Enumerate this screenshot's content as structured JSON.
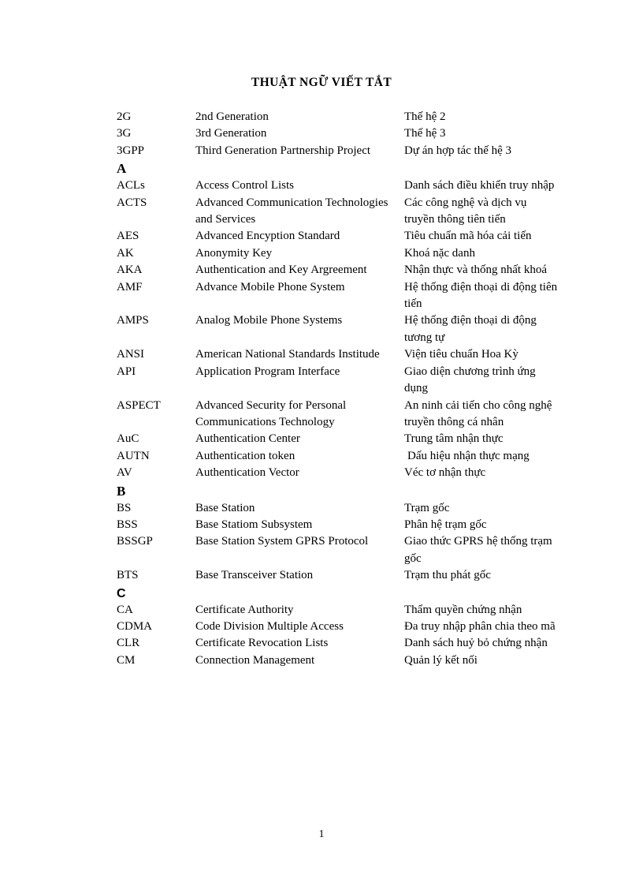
{
  "document": {
    "title": "THUẬT NGỮ VIẾT TẮT",
    "page_number": "1"
  },
  "glossary": {
    "blocks": [
      {
        "type": "entries",
        "rows": [
          {
            "abbr": "2G",
            "english": "2nd Generation",
            "vietnamese": "Thế hệ 2"
          },
          {
            "abbr": "3G",
            "english": "3rd Generation",
            "vietnamese": "Thế hệ 3"
          },
          {
            "abbr": "3GPP",
            "english": "Third Generation Partnership Project",
            "vietnamese": "Dự án hợp tác thế hệ 3"
          }
        ]
      },
      {
        "type": "letter",
        "letter": "A",
        "style": "serif"
      },
      {
        "type": "entries",
        "rows": [
          {
            "abbr": "ACLs",
            "english": "Access Control Lists",
            "vietnamese": "Danh sách điều khiển truy nhập"
          },
          {
            "abbr": "ACTS",
            "english": "Advanced Communication Technologies and Services",
            "vietnamese": "Các công nghệ và dịch vụ truyền thông tiên tiến"
          },
          {
            "abbr": "AES",
            "english": "Advanced Encyption Standard",
            "vietnamese": "Tiêu chuẩn mã hóa cải tiến"
          },
          {
            "abbr": "AK",
            "english": "Anonymity Key",
            "vietnamese": "Khoá nặc danh"
          },
          {
            "abbr": "AKA",
            "english": "Authentication and Key Argreement",
            "vietnamese": "Nhận thực và thống nhất khoá"
          },
          {
            "abbr": "AMF",
            "english": "Advance Mobile Phone System",
            "vietnamese": "Hệ thống điện thoại di động tiên tiến"
          },
          {
            "abbr": "AMPS",
            "english": "Analog Mobile Phone Systems",
            "vietnamese": "Hệ thống điện thoại di động tương tự"
          },
          {
            "abbr": "ANSI",
            "english": "American National Standards Institude",
            "vietnamese": "Viện tiêu chuẩn Hoa Kỳ"
          },
          {
            "abbr": "API",
            "english": "Application Program Interface",
            "vietnamese": "Giao diện chương trình ứng dụng"
          },
          {
            "abbr": "ASPECT",
            "english": "Advanced Security for Personal Communications Technology",
            "vietnamese": "An ninh cải tiến cho công nghệ truyền thông cá nhân"
          },
          {
            "abbr": "AuC",
            "english": "Authentication Center",
            "vietnamese": "Trung tâm nhận thực"
          },
          {
            "abbr": "AUTN",
            "english": "Authentication token",
            "vietnamese": "Dấu hiệu nhận thực mạng",
            "indent_vi": true
          },
          {
            "abbr": "AV",
            "english": "Authentication Vector",
            "vietnamese": "Véc tơ nhận thực"
          }
        ]
      },
      {
        "type": "letter",
        "letter": "B",
        "style": "serif"
      },
      {
        "type": "entries",
        "rows": [
          {
            "abbr": "BS",
            "english": "Base Station",
            "vietnamese": "Trạm gốc"
          },
          {
            "abbr": "BSS",
            "english": "Base Statiom Subsystem",
            "vietnamese": "Phân hệ trạm gốc"
          },
          {
            "abbr": "BSSGP",
            "english": "Base Station System GPRS Protocol",
            "vietnamese": "Giao thức GPRS hệ thống trạm gốc"
          },
          {
            "abbr": "BTS",
            "english": "Base Transceiver Station",
            "vietnamese": "Trạm thu phát gốc"
          }
        ]
      },
      {
        "type": "letter",
        "letter": "C",
        "style": "sans"
      },
      {
        "type": "entries",
        "rows": [
          {
            "abbr": "CA",
            "english": "Certificate Authority",
            "vietnamese": "Thẩm quyền chứng nhận"
          },
          {
            "abbr": "CDMA",
            "english": "Code Division Multiple Access",
            "vietnamese": "Đa truy nhập phân chia theo mã"
          },
          {
            "abbr": "CLR",
            "english": "Certificate Revocation Lists",
            "vietnamese": "Danh sách huỷ bỏ chứng nhận"
          },
          {
            "abbr": "CM",
            "english": "Connection Management",
            "vietnamese": "Quản lý kết nối"
          }
        ]
      }
    ]
  }
}
